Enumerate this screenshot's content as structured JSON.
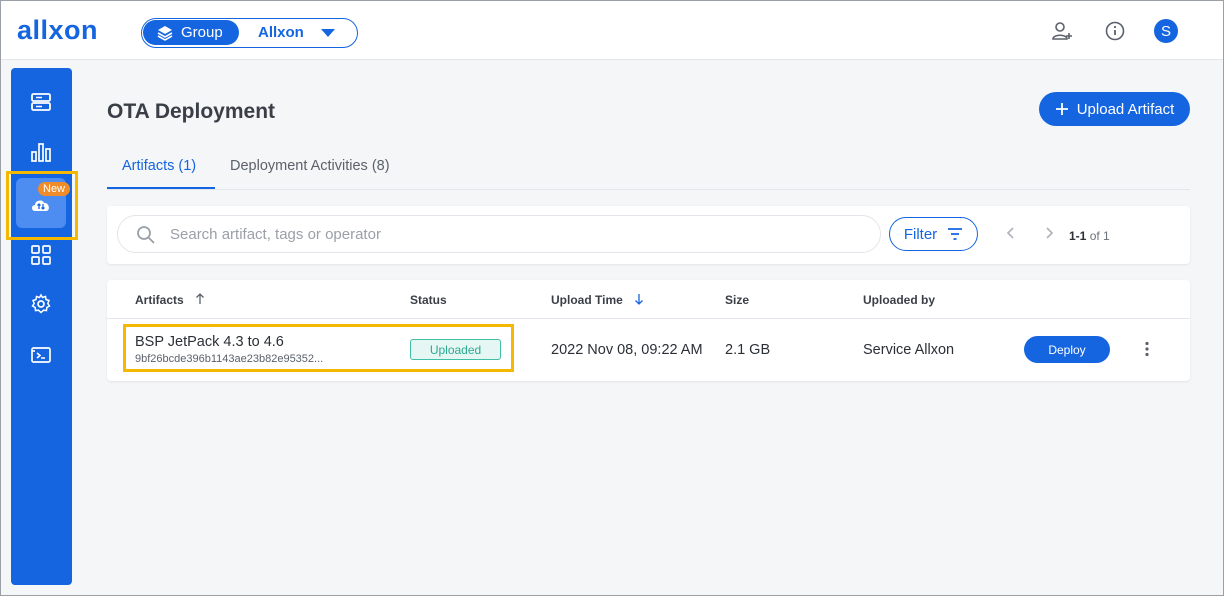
{
  "header": {
    "logo": "allxon",
    "scope_type": "Group",
    "scope_name": "Allxon",
    "avatar_letter": "S",
    "icons": [
      "add-user-icon",
      "info-icon"
    ]
  },
  "sidebar": {
    "items": [
      {
        "name": "devices",
        "icon": "server-icon"
      },
      {
        "name": "dashboard",
        "icon": "bar-chart-icon"
      },
      {
        "name": "ota",
        "icon": "cloud-upload-icon",
        "badge": "New",
        "active": true
      },
      {
        "name": "apps",
        "icon": "grid-icon"
      },
      {
        "name": "settings",
        "icon": "gear-icon"
      },
      {
        "name": "console",
        "icon": "terminal-icon"
      }
    ]
  },
  "page": {
    "title": "OTA Deployment",
    "upload_label": "Upload Artifact",
    "tabs": [
      {
        "label": "Artifacts (1)",
        "active": true
      },
      {
        "label": "Deployment Activities (8)",
        "active": false
      }
    ]
  },
  "toolbar": {
    "search_placeholder": "Search artifact, tags or operator",
    "filter_label": "Filter",
    "pager_range": "1-1",
    "pager_total": "of 1"
  },
  "table": {
    "headers": {
      "artifacts": "Artifacts",
      "status": "Status",
      "upload_time": "Upload Time",
      "size": "Size",
      "uploaded_by": "Uploaded by"
    },
    "rows": [
      {
        "name": "BSP JetPack 4.3 to 4.6",
        "hash": "9bf26bcde396b1143ae23b82e95352...",
        "status": "Uploaded",
        "upload_time": "2022 Nov 08, 09:22 AM",
        "size": "2.1 GB",
        "uploaded_by": "Service Allxon",
        "action": "Deploy"
      }
    ]
  },
  "colors": {
    "brand": "#1565e0",
    "highlight": "#f5b800",
    "badge_new": "#f08c2a",
    "status_uploaded": "#2aa98f"
  }
}
